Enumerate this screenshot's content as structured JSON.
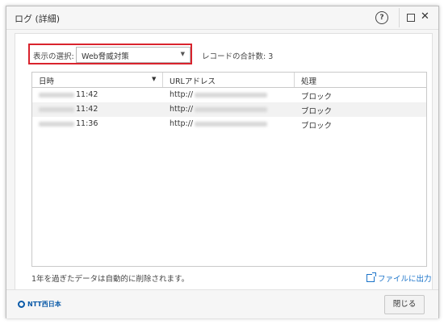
{
  "window": {
    "title": "ログ (詳細)"
  },
  "titlebar_icons": {
    "help": "question-icon",
    "maximize": "maximize-icon",
    "close": "close-icon",
    "help_glyph": "?",
    "close_glyph": "✕"
  },
  "filter": {
    "label": "表示の選択:",
    "selected": "Web脅威対策",
    "accent_color": "#d9232d"
  },
  "record_count": "レコードの合計数: 3",
  "table": {
    "columns": [
      "日時",
      "URLアドレス",
      "処理"
    ],
    "sort_indicator": "▼",
    "rows": [
      {
        "time": "11:42",
        "url": "http://",
        "action": "ブロック"
      },
      {
        "time": "11:42",
        "url": "http://",
        "action": "ブロック"
      },
      {
        "time": "11:36",
        "url": "http://",
        "action": "ブロック"
      }
    ]
  },
  "footnote": "1年を過ぎたデータは自動的に削除されます。",
  "export_link": "ファイルに出力",
  "footer": {
    "logo": "NTT西日本",
    "close_button": "閉じる",
    "brand_color": "#0a5aa8"
  }
}
